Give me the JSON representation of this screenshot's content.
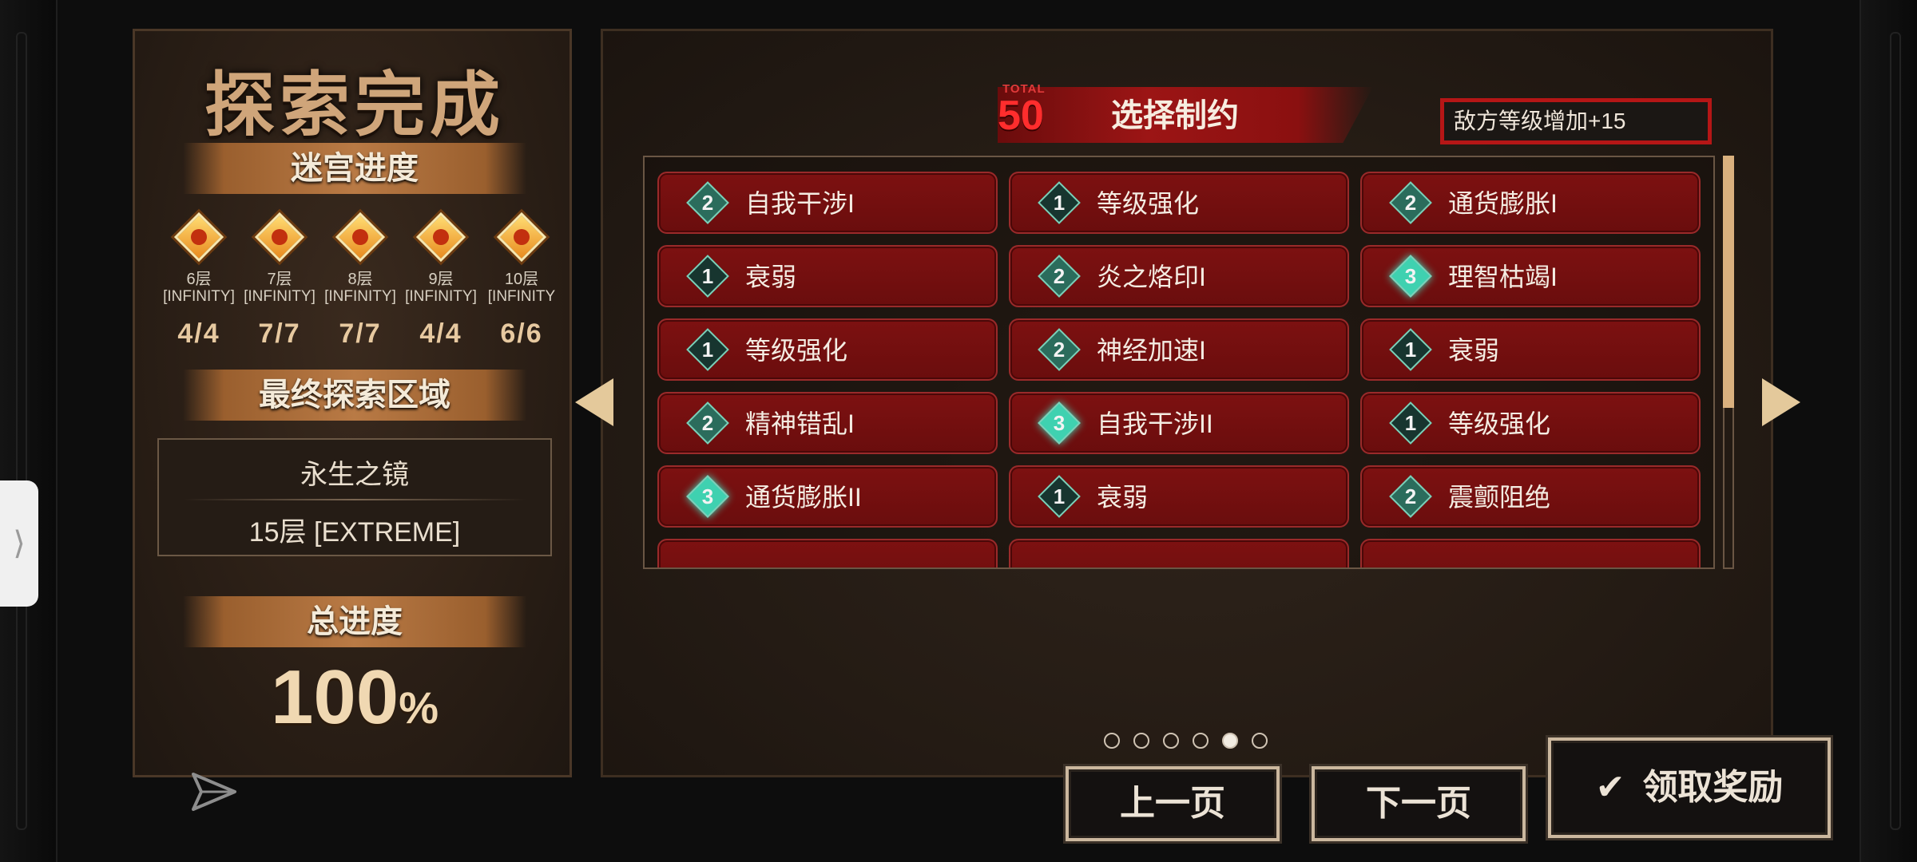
{
  "left": {
    "title": "探索完成",
    "maze_progress_label": "迷宫进度",
    "floors": [
      {
        "floor": "6层",
        "difficulty": "[INFINITY]",
        "count": "4/4"
      },
      {
        "floor": "7层",
        "difficulty": "[INFINITY]",
        "count": "7/7"
      },
      {
        "floor": "8层",
        "difficulty": "[INFINITY]",
        "count": "7/7"
      },
      {
        "floor": "9层",
        "difficulty": "[INFINITY]",
        "count": "4/4"
      },
      {
        "floor": "10层",
        "difficulty": "[INFINITY",
        "count": "6/6"
      }
    ],
    "final_area_label": "最终探索区域",
    "final_area_name": "永生之镜",
    "final_area_floor": "15层 [EXTREME]",
    "total_progress_label": "总进度",
    "total_progress_value": "100",
    "total_progress_unit": "%"
  },
  "right": {
    "total_label": "TOTAL",
    "total_value": "50",
    "title": "选择制约",
    "effect_text": "敌方等级增加+15",
    "constraints": [
      {
        "level": "2",
        "name": "自我干涉I"
      },
      {
        "level": "1",
        "name": "等级强化"
      },
      {
        "level": "2",
        "name": "通货膨胀I"
      },
      {
        "level": "1",
        "name": "衰弱"
      },
      {
        "level": "2",
        "name": "炎之烙印I"
      },
      {
        "level": "3",
        "name": "理智枯竭I"
      },
      {
        "level": "1",
        "name": "等级强化"
      },
      {
        "level": "2",
        "name": "神经加速I"
      },
      {
        "level": "1",
        "name": "衰弱"
      },
      {
        "level": "2",
        "name": "精神错乱I"
      },
      {
        "level": "3",
        "name": "自我干涉II"
      },
      {
        "level": "1",
        "name": "等级强化"
      },
      {
        "level": "3",
        "name": "通货膨胀II"
      },
      {
        "level": "1",
        "name": "衰弱"
      },
      {
        "level": "2",
        "name": "震颤阻绝"
      }
    ],
    "page_count": 6,
    "current_page": 5
  },
  "buttons": {
    "prev_label": "上一页",
    "next_label": "下一页",
    "claim_label": "领取奖励"
  },
  "icons": {
    "check": "check-icon",
    "arrow_left": "arrow-left-icon",
    "arrow_right": "arrow-right-icon",
    "send": "send-icon",
    "side_tab": "chevron-right-icon"
  },
  "colors": {
    "accent_red": "#b51616",
    "constraint_bg": "#7d1111",
    "teal_level": "#3fd1b0",
    "gold": "#e4c99b"
  }
}
